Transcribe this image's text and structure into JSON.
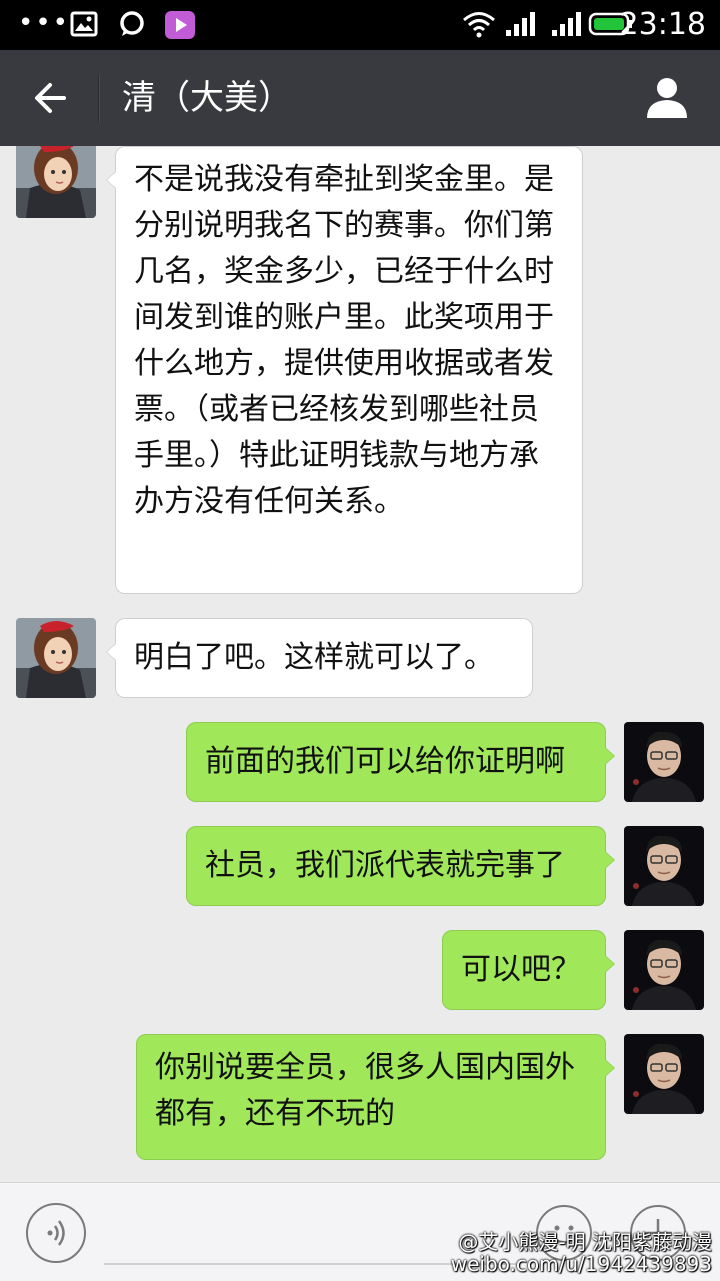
{
  "status_bar": {
    "time": "23:18",
    "icons": [
      "more-dots-icon",
      "gallery-icon",
      "chat-bubble-icon",
      "video-app-icon",
      "wifi-icon",
      "signal-icon",
      "signal-icon",
      "battery-icon"
    ]
  },
  "header": {
    "title": "清（大美）",
    "back_icon": "back-arrow-icon",
    "profile_icon": "person-icon"
  },
  "messages": [
    {
      "side": "in",
      "text": "不是说我没有牵扯到奖金里。是分别说明我名下的赛事。你们第几名，奖金多少，已经于什么时间发到谁的账户里。此奖项用于什么地方，提供使用收据或者发票。（或者已经核发到哪些社员手里。）特此证明钱款与地方承办方没有任何关系。"
    },
    {
      "side": "in",
      "text": "明白了吧。这样就可以了。"
    },
    {
      "side": "out",
      "text": "前面的我们可以给你证明啊"
    },
    {
      "side": "out",
      "text": "社员，我们派代表就完事了"
    },
    {
      "side": "out",
      "text": "可以吧？"
    },
    {
      "side": "out",
      "text": "你别说要全员，很多人国内国外都有，还有不玩的"
    }
  ],
  "bottom_bar": {
    "voice_icon": "voice-icon",
    "emoji_icon": "emoji-icon",
    "plus_icon": "plus-icon"
  },
  "watermark": {
    "line1": "@艾小熊漫-明  沈阳紫藤动漫",
    "line2": "weibo.com/u/1942439893"
  },
  "colors": {
    "header_bg": "#393a3f",
    "chat_bg": "#ebebeb",
    "out_bubble": "#a0e75a",
    "in_bubble": "#ffffff"
  }
}
